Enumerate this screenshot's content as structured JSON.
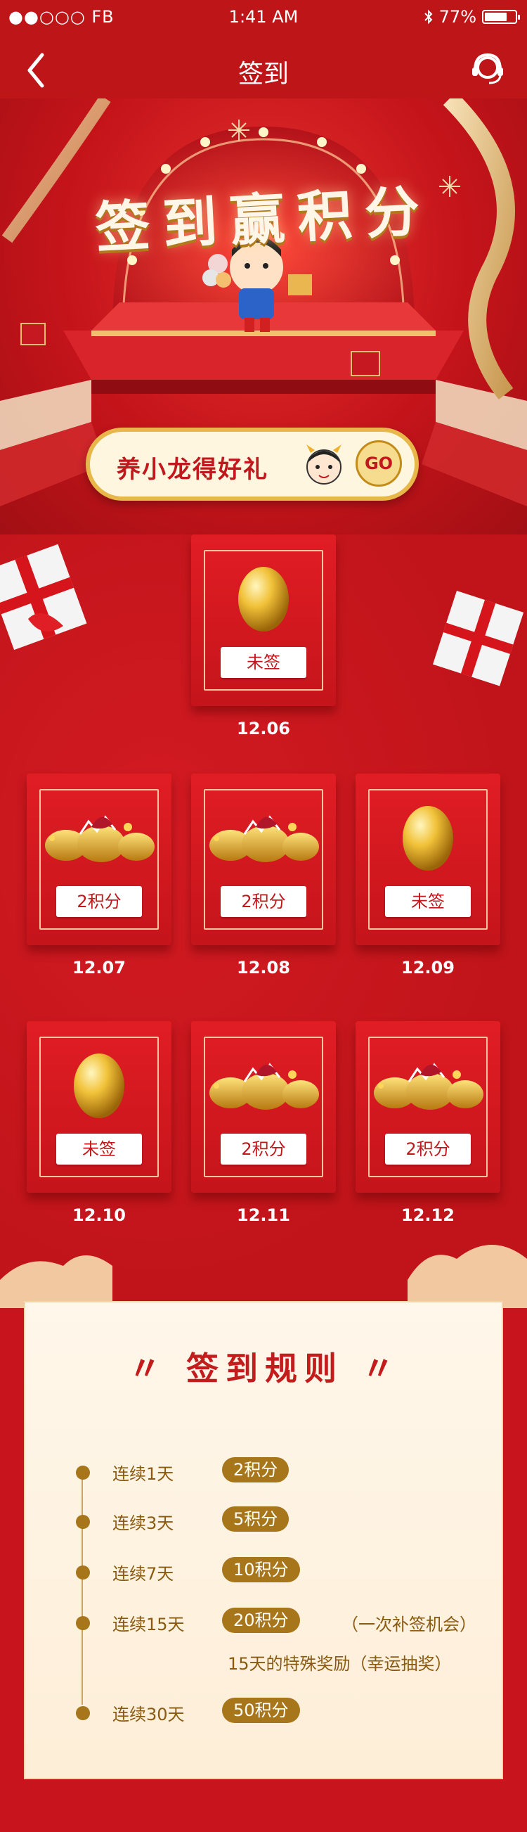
{
  "status_bar": {
    "carrier": "●●○○○ FB",
    "time": "1:41 AM",
    "battery": "77%",
    "battery_level": 0.77
  },
  "nav": {
    "title": "签到"
  },
  "hero": {
    "title": "签到赢积分"
  },
  "promo": {
    "text": "养小龙得好礼",
    "go_label": "GO"
  },
  "checkin_cards": [
    {
      "date": "12.06",
      "status": "未签",
      "state": "unsigned"
    },
    {
      "date": "12.07",
      "status": "2积分",
      "state": "signed"
    },
    {
      "date": "12.08",
      "status": "2积分",
      "state": "signed"
    },
    {
      "date": "12.09",
      "status": "未签",
      "state": "unsigned"
    },
    {
      "date": "12.10",
      "status": "未签",
      "state": "unsigned"
    },
    {
      "date": "12.11",
      "status": "2积分",
      "state": "signed"
    },
    {
      "date": "12.12",
      "status": "2积分",
      "state": "signed"
    }
  ],
  "rules": {
    "title": "签到规则",
    "items": [
      {
        "label": "连续1天",
        "points": "2积分",
        "note": ""
      },
      {
        "label": "连续3天",
        "points": "5积分",
        "note": ""
      },
      {
        "label": "连续7天",
        "points": "10积分",
        "note": ""
      },
      {
        "label": "连续15天",
        "points": "20积分",
        "note": "（一次补签机会）"
      },
      {
        "label": "连续30天",
        "points": "50积分",
        "note": ""
      }
    ],
    "extra_note": "15天的特殊奖励（幸运抽奖）"
  },
  "colors": {
    "primary_red": "#c8141c",
    "gold": "#a8761a",
    "cream": "#fff7eb"
  }
}
